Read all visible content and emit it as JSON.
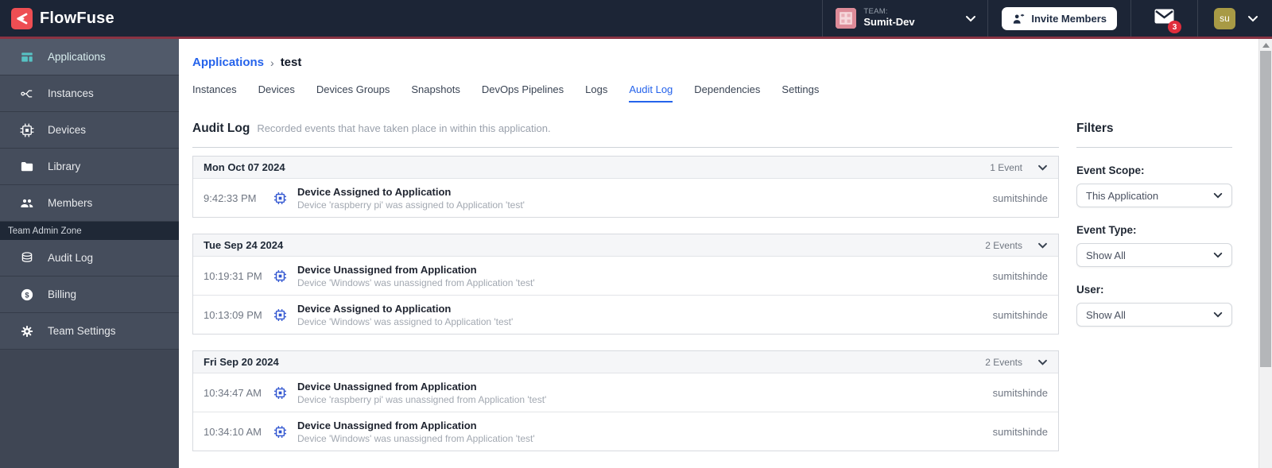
{
  "header": {
    "brand": "FlowFuse",
    "team_label": "TEAM:",
    "team_name": "Sumit-Dev",
    "invite_button": "Invite Members",
    "notification_count": "3",
    "avatar_initials": "su"
  },
  "sidebar": {
    "items": [
      {
        "label": "Applications"
      },
      {
        "label": "Instances"
      },
      {
        "label": "Devices"
      },
      {
        "label": "Library"
      },
      {
        "label": "Members"
      }
    ],
    "admin_zone_label": "Team Admin Zone",
    "admin_items": [
      {
        "label": "Audit Log"
      },
      {
        "label": "Billing"
      },
      {
        "label": "Team Settings"
      }
    ]
  },
  "breadcrumb": {
    "parent": "Applications",
    "separator": "›",
    "current": "test"
  },
  "tabs": [
    "Instances",
    "Devices",
    "Devices Groups",
    "Snapshots",
    "DevOps Pipelines",
    "Logs",
    "Audit Log",
    "Dependencies",
    "Settings"
  ],
  "audit_log": {
    "title": "Audit Log",
    "description": "Recorded events that have taken place in within this application.",
    "groups": [
      {
        "date": "Mon Oct 07 2024",
        "count_label": "1 Event",
        "events": [
          {
            "time": "9:42:33 PM",
            "title": "Device Assigned to Application",
            "description": "Device 'raspberry pi' was assigned to Application 'test'",
            "user": "sumitshinde"
          }
        ]
      },
      {
        "date": "Tue Sep 24 2024",
        "count_label": "2 Events",
        "events": [
          {
            "time": "10:19:31 PM",
            "title": "Device Unassigned from Application",
            "description": "Device 'Windows' was unassigned from Application 'test'",
            "user": "sumitshinde"
          },
          {
            "time": "10:13:09 PM",
            "title": "Device Assigned to Application",
            "description": "Device 'Windows' was assigned to Application 'test'",
            "user": "sumitshinde"
          }
        ]
      },
      {
        "date": "Fri Sep 20 2024",
        "count_label": "2 Events",
        "events": [
          {
            "time": "10:34:47 AM",
            "title": "Device Unassigned from Application",
            "description": "Device 'raspberry pi' was unassigned from Application 'test'",
            "user": "sumitshinde"
          },
          {
            "time": "10:34:10 AM",
            "title": "Device Unassigned from Application",
            "description": "Device 'Windows' was unassigned from Application 'test'",
            "user": "sumitshinde"
          }
        ]
      }
    ]
  },
  "filters": {
    "title": "Filters",
    "fields": [
      {
        "label": "Event Scope:",
        "value": "This Application"
      },
      {
        "label": "Event Type:",
        "value": "Show All"
      },
      {
        "label": "User:",
        "value": "Show All"
      }
    ]
  },
  "colors": {
    "header_bg": "#1c2536",
    "accent_red": "#8a3343",
    "brand_red": "#ee4e53",
    "link_blue": "#2563eb",
    "chip_blue": "#2f54d0",
    "sidebar_teal": "#57c2c4",
    "badge_red": "#e02d3c"
  }
}
